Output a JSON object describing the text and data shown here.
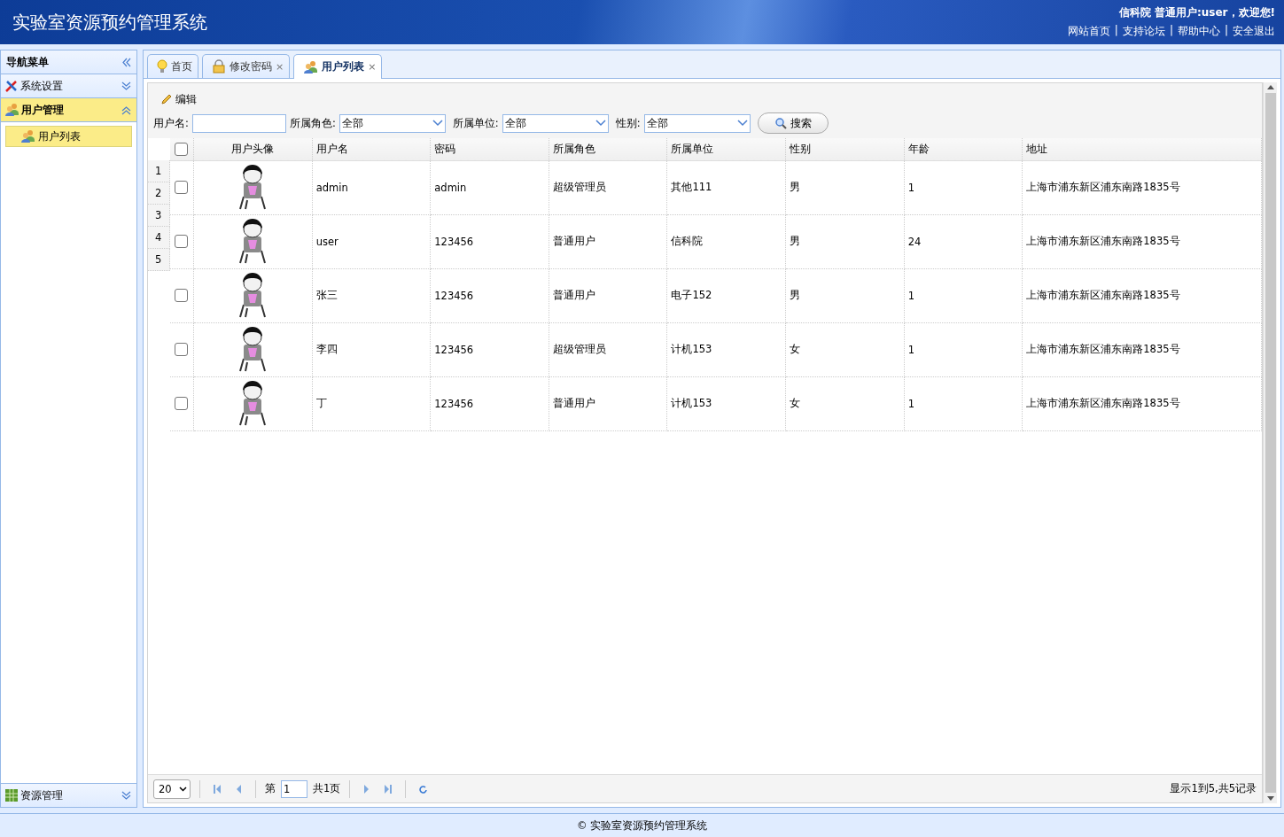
{
  "header": {
    "title": "实验室资源预约管理系统",
    "welcome": "信科院 普通用户:user，欢迎您!",
    "links": [
      "网站首页",
      "支持论坛",
      "帮助中心",
      "安全退出"
    ],
    "separator": "|"
  },
  "sidebar": {
    "title": "导航菜单",
    "sections": [
      {
        "label": "系统设置",
        "expanded": false
      },
      {
        "label": "用户管理",
        "expanded": true,
        "children": [
          {
            "label": "用户列表",
            "selected": true
          }
        ]
      },
      {
        "label": "资源管理",
        "expanded": false
      }
    ]
  },
  "tabs": [
    {
      "label": "首页",
      "selected": false
    },
    {
      "label": "修改密码",
      "close": "×",
      "selected": false
    },
    {
      "label": "用户列表",
      "close": "×",
      "selected": true
    }
  ],
  "toolbar": {
    "edit": "编辑"
  },
  "filters": [
    {
      "label": "用户名:",
      "kind": "text"
    },
    {
      "label": "所属角色:",
      "kind": "select",
      "value": "全部"
    },
    {
      "label": "所属单位:",
      "kind": "select",
      "value": "全部"
    },
    {
      "label": "性别:",
      "kind": "select",
      "value": "全部"
    }
  ],
  "search_button": "搜索",
  "row_numbers": [
    "1",
    "2",
    "3",
    "4",
    "5"
  ],
  "table": {
    "all_checked": false,
    "columns": [
      "用户头像",
      "用户名",
      "密码",
      "所属角色",
      "所属单位",
      "性别",
      "年龄",
      "地址"
    ],
    "rows": [
      {
        "checked": false,
        "cells": [
          "",
          "admin",
          "admin",
          "超级管理员",
          "其他111",
          "男",
          "1",
          "上海市浦东新区浦东南路1835号"
        ]
      },
      {
        "checked": false,
        "cells": [
          "",
          "user",
          "123456",
          "普通用户",
          "信科院",
          "男",
          "24",
          "上海市浦东新区浦东南路1835号"
        ]
      },
      {
        "checked": false,
        "cells": [
          "",
          "张三",
          "123456",
          "普通用户",
          "电子152",
          "男",
          "1",
          "上海市浦东新区浦东南路1835号"
        ]
      },
      {
        "checked": false,
        "cells": [
          "",
          "李四",
          "123456",
          "超级管理员",
          "计机153",
          "女",
          "1",
          "上海市浦东新区浦东南路1835号"
        ]
      },
      {
        "checked": false,
        "cells": [
          "",
          "丁",
          "123456",
          "普通用户",
          "计机153",
          "女",
          "1",
          "上海市浦东新区浦东南路1835号"
        ]
      }
    ]
  },
  "pager": {
    "page_size": "20",
    "page_prefix": "第",
    "page": "1",
    "page_total": "共1页",
    "summary": "显示1到5,共5记录"
  },
  "footer": "© 实验室资源预约管理系统"
}
